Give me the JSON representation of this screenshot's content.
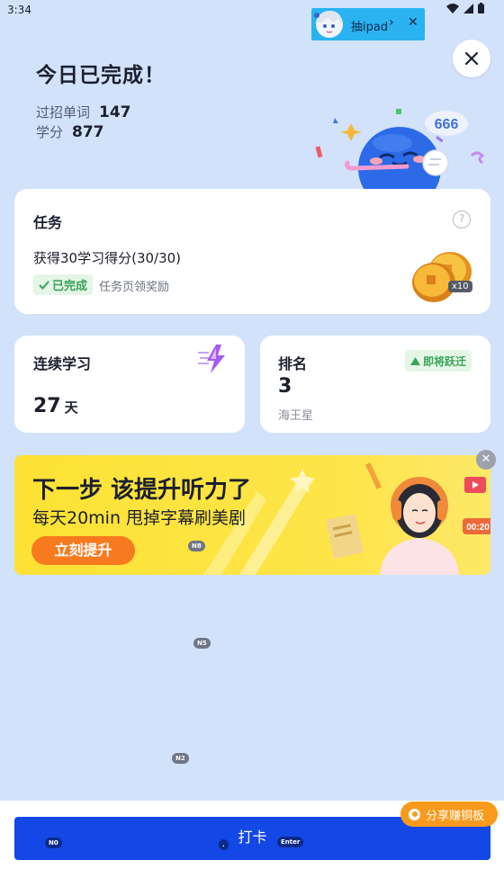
{
  "status_bar": {
    "time": "3:34"
  },
  "promo": {
    "label": "抽ipad",
    "arrow": "›",
    "close": "✕"
  },
  "header": {
    "title": "今日已完成！",
    "words_label": "过招单词",
    "words_value": "147",
    "score_label": "学分",
    "score_value": "877",
    "mascot_bubble": "666"
  },
  "task_card": {
    "title": "任务",
    "description": "获得30学习得分(30/30)",
    "done_label": "已完成",
    "reward_note": "任务页领奖励",
    "coin_multiplier": "x10"
  },
  "streak_card": {
    "title": "连续学习",
    "value": "27",
    "unit": "天"
  },
  "rank_card": {
    "title": "排名",
    "value": "3",
    "tier": "海王星",
    "badge": "即将跃迁"
  },
  "banner": {
    "title": "下一步 该提升听力了",
    "subtitle": "每天20min 甩掉字幕刷美剧",
    "cta": "立刻提升",
    "timer": "00:20"
  },
  "hints": {
    "n8": "N8",
    "n5": "N5",
    "n2": "N2",
    "n0": "N0",
    "enter": "Enter",
    "dot": "."
  },
  "bottom": {
    "checkin_label": "打卡",
    "share_label": "分享赚铜板"
  },
  "colors": {
    "background": "#d2e2fb",
    "primary": "#1348e6",
    "accent": "#f99a1c",
    "success": "#3aa35a"
  }
}
